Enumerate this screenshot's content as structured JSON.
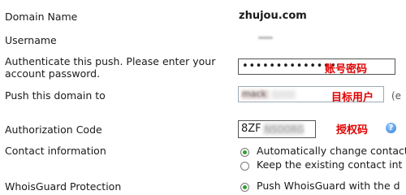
{
  "fields": {
    "domain_name": {
      "label": "Domain Name",
      "value": "zhujou.com"
    },
    "username": {
      "label": "Username"
    },
    "authenticate": {
      "label_line1": "Authenticate this push. Please enter your",
      "label_line2": "account password.",
      "masked_value": "••••••••••••••",
      "annotation": "账号密码"
    },
    "push_to": {
      "label": "Push this domain to",
      "value_blurred": "mack",
      "annotation": "目标用户",
      "trailing_cut": "(e"
    },
    "auth_code": {
      "label": "Authorization Code",
      "value_visible": "8ZF",
      "value_blurred": "NSOORG",
      "annotation": "授权码",
      "help_icon": "question-help-icon"
    },
    "contact": {
      "label": "Contact information",
      "options": [
        {
          "label": "Automatically change contact",
          "checked": true
        },
        {
          "label": "Keep the existing contact int",
          "checked": false
        }
      ]
    },
    "whoisguard": {
      "label": "WhoisGuard Protection",
      "options": [
        {
          "label": "Push WhoisGuard with the d",
          "checked": true
        }
      ]
    }
  },
  "colors": {
    "annotation": "#e00000",
    "radio_checked": "#2ea12e",
    "input_border": "#7f9db9"
  }
}
